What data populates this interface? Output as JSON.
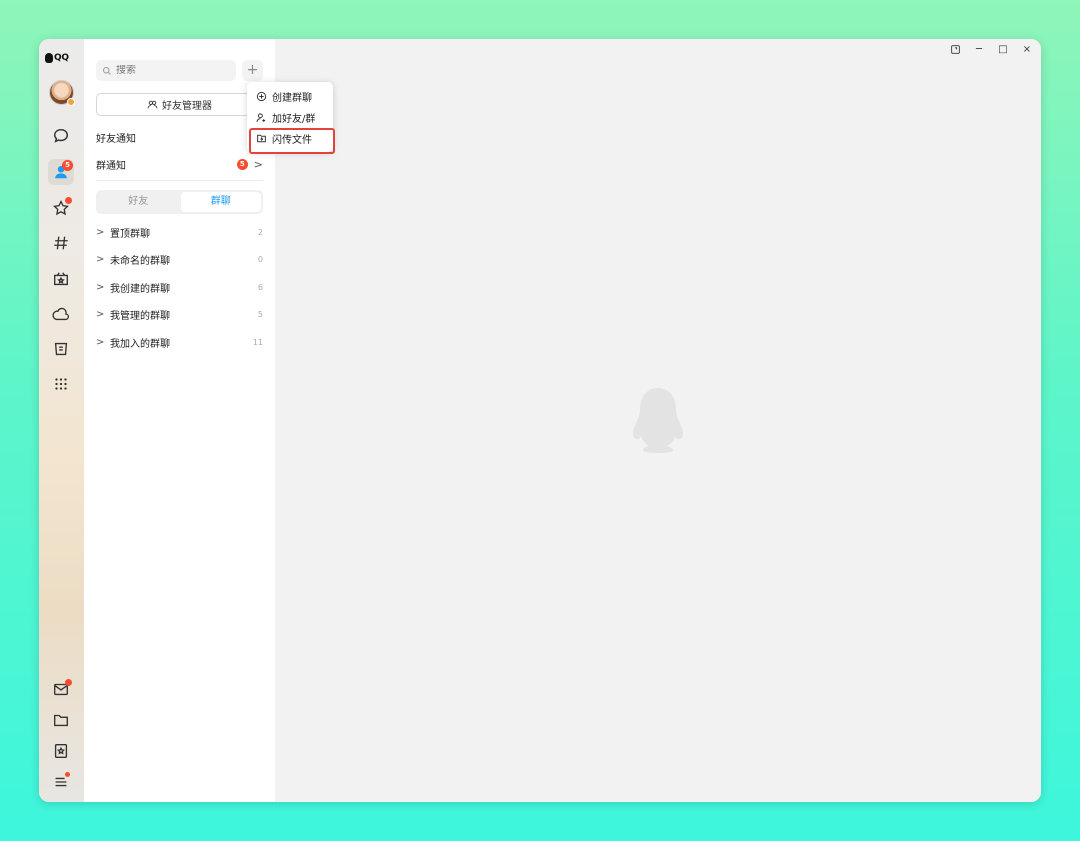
{
  "app": {
    "logo_text": "QQ"
  },
  "rail": {
    "contacts_badge": "5",
    "items": [
      {
        "name": "messages",
        "icon": "chat-bubble-icon"
      },
      {
        "name": "contacts",
        "icon": "contacts-icon",
        "active": true
      },
      {
        "name": "favorites",
        "icon": "star-icon"
      },
      {
        "name": "channels",
        "icon": "hash-icon"
      },
      {
        "name": "games",
        "icon": "sparkle-bag-icon"
      },
      {
        "name": "cloud",
        "icon": "cloud-icon"
      },
      {
        "name": "shop",
        "icon": "shop-icon"
      },
      {
        "name": "apps",
        "icon": "grid-dots-icon"
      }
    ],
    "bottom_items": [
      {
        "name": "mail",
        "icon": "mail-icon"
      },
      {
        "name": "files",
        "icon": "folder-icon"
      },
      {
        "name": "collections",
        "icon": "bookmark-star-icon"
      },
      {
        "name": "menu",
        "icon": "hamburger-menu-icon"
      }
    ]
  },
  "panel": {
    "search_placeholder": "搜索",
    "plus_label": "+",
    "friend_manager_label": "好友管理器",
    "friend_notice_label": "好友通知",
    "group_notice_label": "群通知",
    "group_notice_badge": "5",
    "tabs": [
      {
        "label": "好友",
        "active": false
      },
      {
        "label": "群聊",
        "active": true
      }
    ],
    "groups": [
      {
        "name": "置顶群聊",
        "count": "2"
      },
      {
        "name": "未命名的群聊",
        "count": "0"
      },
      {
        "name": "我创建的群聊",
        "count": "6"
      },
      {
        "name": "我管理的群聊",
        "count": "5"
      },
      {
        "name": "我加入的群聊",
        "count": "11"
      }
    ]
  },
  "menu": {
    "items": [
      {
        "label": "创建群聊",
        "icon": "plus-circle-icon"
      },
      {
        "label": "加好友/群",
        "icon": "add-person-icon"
      },
      {
        "label": "闪传文件",
        "icon": "flash-file-icon",
        "highlighted": true
      }
    ]
  },
  "colors": {
    "accent": "#1e9bf0",
    "badge": "#f74c30",
    "highlight_border": "#e0443a"
  }
}
